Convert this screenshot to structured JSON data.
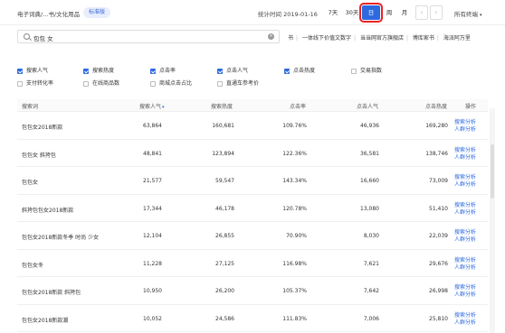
{
  "header": {
    "breadcrumb": "电子词典/...书/文化用品",
    "badge": "标准版",
    "stat_time": "统计时间 2019-01-16",
    "periods": {
      "d7": "7天",
      "d30": "30天",
      "day": "日",
      "week": "周",
      "month": "月"
    },
    "prev": "‹",
    "next": "›",
    "terminal": "所有终端",
    "terminal_caret": "▾"
  },
  "search": {
    "value": "包包 女",
    "clear": "×"
  },
  "tags": [
    "书",
    "一体线下价值文数字",
    "当当网官方旗舰店",
    "博库家书",
    "海派阿万里"
  ],
  "checkboxes": [
    {
      "label": "搜索人气",
      "checked": true
    },
    {
      "label": "搜索热度",
      "checked": true
    },
    {
      "label": "点击率",
      "checked": true
    },
    {
      "label": "点击人气",
      "checked": true
    },
    {
      "label": "点击热度",
      "checked": true
    },
    {
      "label": "交易指数",
      "checked": false
    },
    {
      "label": "支付转化率",
      "checked": false
    },
    {
      "label": "在线商品数",
      "checked": false
    },
    {
      "label": "商城点击占比",
      "checked": false
    },
    {
      "label": "直通车参考价",
      "checked": false
    }
  ],
  "table": {
    "headers": {
      "keyword": "搜索词",
      "search_pop": "搜索人气",
      "search_pop_sort": "▾",
      "search_heat": "搜索热度",
      "ctr": "点击率",
      "click_pop": "点击人气",
      "click_heat": "点击热度",
      "action": "操作"
    },
    "action_labels": {
      "analyze": "搜索分析",
      "crowd": "人群分析"
    },
    "rows": [
      {
        "keyword": "包包女2018新款",
        "search_pop": "63,864",
        "search_heat": "160,681",
        "ctr": "109.76%",
        "click_pop": "46,936",
        "click_heat": "169,280"
      },
      {
        "keyword": "包包女 斜挎包",
        "search_pop": "48,841",
        "search_heat": "123,894",
        "ctr": "122.36%",
        "click_pop": "36,581",
        "click_heat": "138,746"
      },
      {
        "keyword": "包包女",
        "search_pop": "21,577",
        "search_heat": "59,547",
        "ctr": "143.34%",
        "click_pop": "16,660",
        "click_heat": "73,009"
      },
      {
        "keyword": "斜挎包包女2018新款",
        "search_pop": "17,344",
        "search_heat": "46,178",
        "ctr": "120.78%",
        "click_pop": "13,080",
        "click_heat": "51,410"
      },
      {
        "keyword": "包包女2018新款冬季 时尚 少女",
        "search_pop": "12,104",
        "search_heat": "26,855",
        "ctr": "70.90%",
        "click_pop": "8,030",
        "click_heat": "22,039"
      },
      {
        "keyword": "包包女冬",
        "search_pop": "11,228",
        "search_heat": "27,125",
        "ctr": "116.98%",
        "click_pop": "7,621",
        "click_heat": "29,676"
      },
      {
        "keyword": "包包女2018新款 斜挎包",
        "search_pop": "10,950",
        "search_heat": "26,200",
        "ctr": "105.37%",
        "click_pop": "7,642",
        "click_heat": "26,998"
      },
      {
        "keyword": "包包女2018新款潮",
        "search_pop": "10,052",
        "search_heat": "24,586",
        "ctr": "111.83%",
        "click_pop": "7,006",
        "click_heat": "25,810"
      }
    ]
  }
}
